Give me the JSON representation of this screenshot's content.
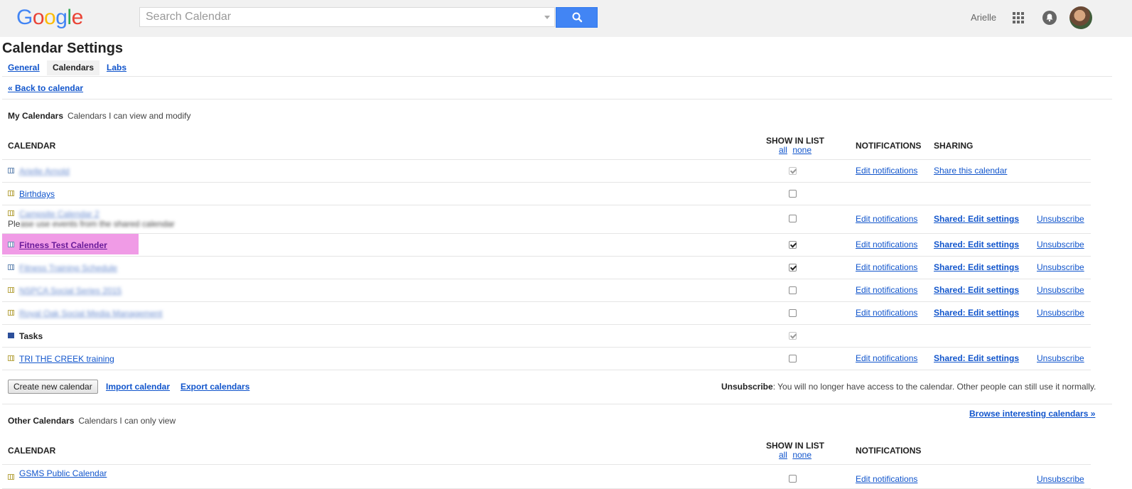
{
  "header": {
    "logo": "Google",
    "logo_colors": [
      "#4285f4",
      "#ea4335",
      "#fbbc05",
      "#4285f4",
      "#34a853",
      "#ea4335"
    ],
    "search_placeholder": "Search Calendar",
    "search_button_icon": "search-icon",
    "username": "Arielle",
    "apps_icon": "apps-grid-icon",
    "notifications_icon": "bell-icon"
  },
  "page": {
    "title": "Calendar Settings",
    "tabs": [
      {
        "label": "General",
        "active": false
      },
      {
        "label": "Calendars",
        "active": true
      },
      {
        "label": "Labs",
        "active": false
      }
    ],
    "back_link": "« Back to calendar"
  },
  "my_calendars": {
    "title": "My Calendars",
    "subtitle": "Calendars I can view and modify",
    "columns": {
      "calendar": "CALENDAR",
      "show_in_list": "SHOW IN LIST",
      "all": "all",
      "none": "none",
      "notifications": "NOTIFICATIONS",
      "sharing": "SHARING"
    },
    "rows": [
      {
        "name": "Arielle Arnold",
        "blurred": true,
        "checked": true,
        "disabled": true,
        "notifications": "Edit notifications",
        "sharing": "Share this calendar",
        "sharing_bold": false,
        "unsubscribe": ""
      },
      {
        "name": "Birthdays",
        "blurred": false,
        "checked": false,
        "disabled": false,
        "notifications": "",
        "sharing": "",
        "sharing_bold": false,
        "unsubscribe": ""
      },
      {
        "name": "Campsite Calendar 2",
        "note": "Please use events from the shared calendar",
        "blurred": true,
        "checked": false,
        "disabled": false,
        "notifications": "Edit notifications",
        "sharing": "Shared: Edit settings",
        "sharing_bold": true,
        "unsubscribe": "Unsubscribe"
      },
      {
        "name": "Fitness Test Calender",
        "blurred": false,
        "highlighted": true,
        "checked": true,
        "disabled": false,
        "notifications": "Edit notifications",
        "sharing": "Shared: Edit settings",
        "sharing_bold": true,
        "unsubscribe": "Unsubscribe"
      },
      {
        "name": "Fitness Training Schedule",
        "blurred": true,
        "checked": true,
        "disabled": false,
        "notifications": "Edit notifications",
        "sharing": "Shared: Edit settings",
        "sharing_bold": true,
        "unsubscribe": "Unsubscribe"
      },
      {
        "name": "NSPCA Social Series 2015",
        "blurred": true,
        "checked": false,
        "disabled": false,
        "notifications": "Edit notifications",
        "sharing": "Shared: Edit settings",
        "sharing_bold": true,
        "unsubscribe": "Unsubscribe"
      },
      {
        "name": "Royal Oak Social Media Management",
        "blurred": true,
        "checked": false,
        "disabled": false,
        "notifications": "Edit notifications",
        "sharing": "Shared: Edit settings",
        "sharing_bold": true,
        "unsubscribe": "Unsubscribe"
      },
      {
        "name": "Tasks",
        "blurred": false,
        "bold": true,
        "checked": true,
        "disabled": true,
        "notifications": "",
        "sharing": "",
        "sharing_bold": false,
        "unsubscribe": ""
      },
      {
        "name": "TRI THE CREEK training",
        "blurred": false,
        "checked": false,
        "disabled": false,
        "notifications": "Edit notifications",
        "sharing": "Shared: Edit settings",
        "sharing_bold": true,
        "unsubscribe": "Unsubscribe"
      }
    ],
    "create_button": "Create new calendar",
    "import_link": "Import calendar",
    "export_link": "Export calendars",
    "unsub_label": "Unsubscribe",
    "unsub_text": ": You will no longer have access to the calendar. Other people can still use it normally."
  },
  "other_calendars": {
    "browse_link": "Browse interesting calendars »",
    "title": "Other Calendars",
    "subtitle": "Calendars I can only view",
    "columns": {
      "calendar": "CALENDAR",
      "show_in_list": "SHOW IN LIST",
      "all": "all",
      "none": "none",
      "notifications": "NOTIFICATIONS"
    },
    "rows": [
      {
        "name": "GSMS Public Calendar",
        "notifications": "Edit notifications",
        "unsubscribe": "Unsubscribe"
      }
    ]
  },
  "colors": {
    "link": "#1155cc",
    "highlight": "#f09be6",
    "topbar": "#f1f1f1",
    "search_button": "#4285f4"
  }
}
